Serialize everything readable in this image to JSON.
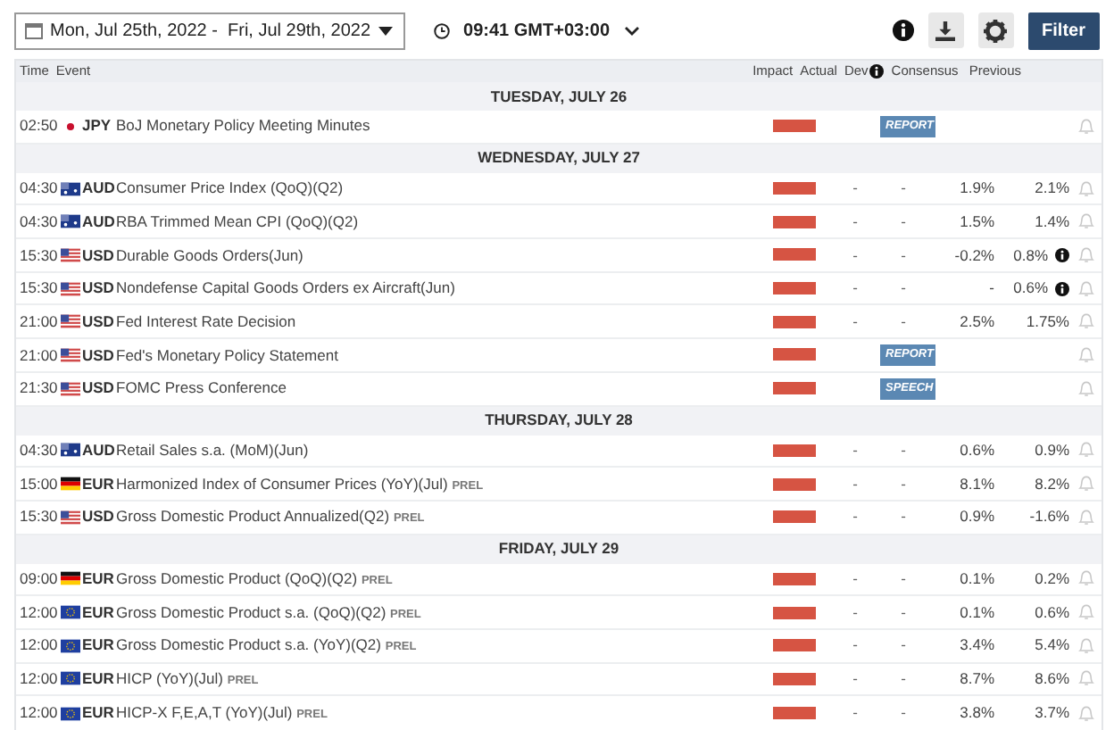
{
  "toolbar": {
    "date_range": "Mon, Jul 25th, 2022 -  Fri, Jul 29th, 2022",
    "time": "09:41 GMT+03:00",
    "filter_button": "Filter"
  },
  "columns": {
    "time": "Time",
    "event": "Event",
    "impact": "Impact",
    "actual": "Actual",
    "dev": "Dev",
    "consensus": "Consensus",
    "previous": "Previous"
  },
  "days": [
    {
      "label": "TUESDAY, JULY 26",
      "events": [
        {
          "time": "02:50",
          "kind": "jp",
          "currency": "JPY",
          "event": "BoJ Monetary Policy Meeting Minutes",
          "color": "#d65443",
          "badge": "REPORT"
        }
      ]
    },
    {
      "label": "WEDNESDAY, JULY 27",
      "events": [
        {
          "time": "04:30",
          "kind": "au",
          "currency": "AUD",
          "event": "Consumer Price Index (QoQ)(Q2)",
          "color": "#d65443",
          "actual": "-",
          "dev": "-",
          "consensus": "1.9%",
          "previous": "2.1%"
        },
        {
          "time": "04:30",
          "kind": "au",
          "currency": "AUD",
          "event": "RBA Trimmed Mean CPI (QoQ)(Q2)",
          "color": "#d65443",
          "actual": "-",
          "dev": "-",
          "consensus": "1.5%",
          "previous": "1.4%"
        },
        {
          "time": "15:30",
          "kind": "us",
          "currency": "USD",
          "event": "Durable Goods Orders(Jun)",
          "color": "#d65443",
          "actual": "-",
          "dev": "-",
          "consensus": "-0.2%",
          "previous": "0.8%",
          "info": true
        },
        {
          "time": "15:30",
          "kind": "us",
          "currency": "USD",
          "event": "Nondefense Capital Goods Orders ex Aircraft(Jun)",
          "color": "#d65443",
          "actual": "-",
          "dev": "-",
          "consensus": "-",
          "previous": "0.6%",
          "info": true
        },
        {
          "time": "21:00",
          "kind": "us",
          "currency": "USD",
          "event": "Fed Interest Rate Decision",
          "color": "#d65443",
          "actual": "-",
          "dev": "-",
          "consensus": "2.5%",
          "previous": "1.75%"
        },
        {
          "time": "21:00",
          "kind": "us",
          "currency": "USD",
          "event": "Fed's Monetary Policy Statement",
          "color": "#d65443",
          "badge": "REPORT"
        },
        {
          "time": "21:30",
          "kind": "us",
          "currency": "USD",
          "event": "FOMC Press Conference",
          "color": "#d65443",
          "badge": "SPEECH"
        }
      ]
    },
    {
      "label": "THURSDAY, JULY 28",
      "events": [
        {
          "time": "04:30",
          "kind": "au",
          "currency": "AUD",
          "event": "Retail Sales s.a. (MoM)(Jun)",
          "color": "#d65443",
          "actual": "-",
          "dev": "-",
          "consensus": "0.6%",
          "previous": "0.9%"
        },
        {
          "time": "15:00",
          "kind": "de",
          "currency": "EUR",
          "event": "Harmonized Index of Consumer Prices (YoY)(Jul)",
          "tag": "PREL",
          "color": "#d65443",
          "actual": "-",
          "dev": "-",
          "consensus": "8.1%",
          "previous": "8.2%"
        },
        {
          "time": "15:30",
          "kind": "us",
          "currency": "USD",
          "event": "Gross Domestic Product Annualized(Q2)",
          "tag": "PREL",
          "color": "#d65443",
          "actual": "-",
          "dev": "-",
          "consensus": "0.9%",
          "previous": "-1.6%"
        }
      ]
    },
    {
      "label": "FRIDAY, JULY 29",
      "events": [
        {
          "time": "09:00",
          "kind": "de",
          "currency": "EUR",
          "event": "Gross Domestic Product (QoQ)(Q2)",
          "tag": "PREL",
          "color": "#d65443",
          "actual": "-",
          "dev": "-",
          "consensus": "0.1%",
          "previous": "0.2%"
        },
        {
          "time": "12:00",
          "kind": "eu",
          "currency": "EUR",
          "event": "Gross Domestic Product s.a. (QoQ)(Q2)",
          "tag": "PREL",
          "color": "#d65443",
          "actual": "-",
          "dev": "-",
          "consensus": "0.1%",
          "previous": "0.6%"
        },
        {
          "time": "12:00",
          "kind": "eu",
          "currency": "EUR",
          "event": "Gross Domestic Product s.a. (YoY)(Q2)",
          "tag": "PREL",
          "color": "#d65443",
          "actual": "-",
          "dev": "-",
          "consensus": "3.4%",
          "previous": "5.4%"
        },
        {
          "time": "12:00",
          "kind": "eu",
          "currency": "EUR",
          "event": "HICP (YoY)(Jul)",
          "tag": "PREL",
          "color": "#d65443",
          "actual": "-",
          "dev": "-",
          "consensus": "8.7%",
          "previous": "8.6%"
        },
        {
          "time": "12:00",
          "kind": "eu",
          "currency": "EUR",
          "event": "HICP-X F,E,A,T (YoY)(Jul)",
          "tag": "PREL",
          "color": "#d65443",
          "actual": "-",
          "dev": "-",
          "consensus": "3.8%",
          "previous": "3.7%"
        }
      ]
    }
  ]
}
